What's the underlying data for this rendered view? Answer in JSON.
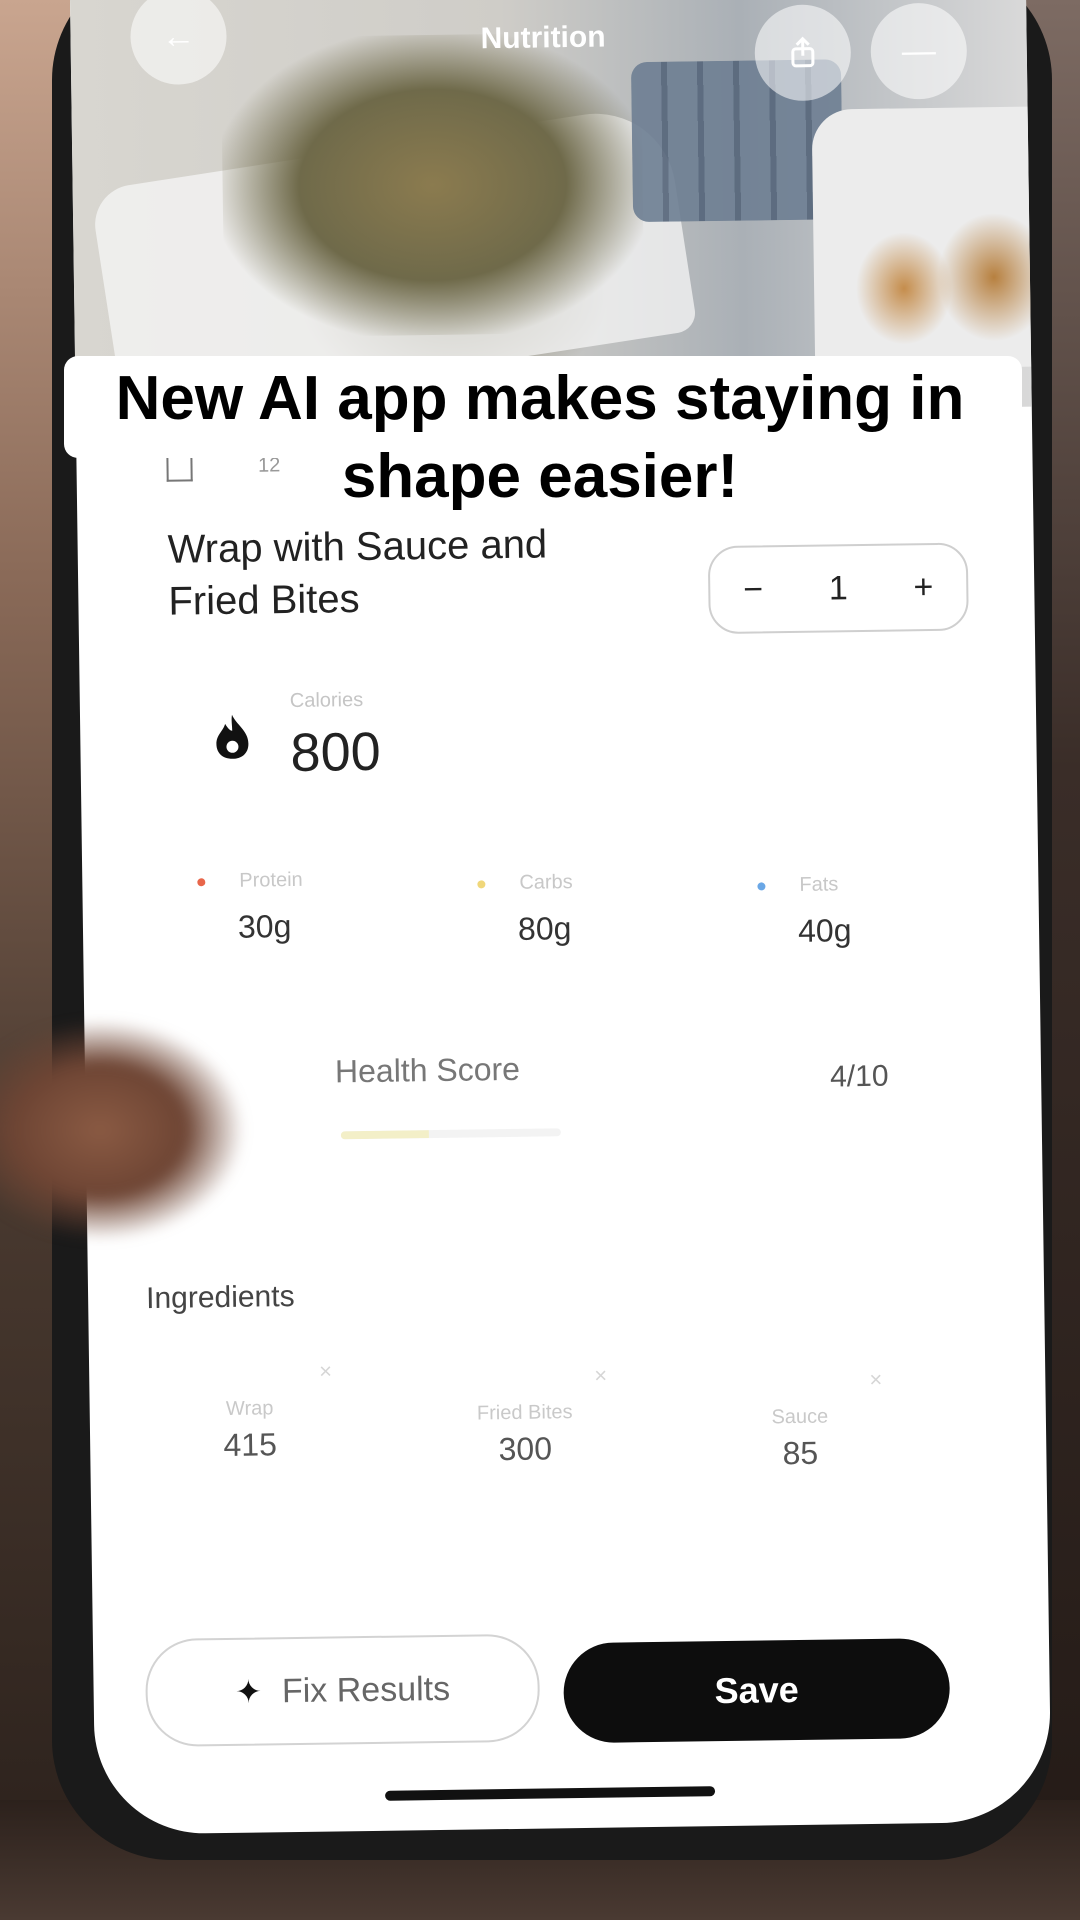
{
  "header": {
    "title": "Nutrition",
    "back_icon": "arrow-left-icon",
    "share_icon": "share-icon",
    "more_icon": "minus-icon"
  },
  "caption": {
    "line1": "New AI app makes staying in",
    "line2": "shape easier!"
  },
  "meal": {
    "time": "12",
    "title_line1": "Wrap with Sauce and",
    "title_line2": "Fried Bites",
    "quantity": "1",
    "decrement": "−",
    "increment": "+"
  },
  "calories": {
    "label": "Calories",
    "value": "800",
    "icon": "flame-icon"
  },
  "macros": [
    {
      "label": "Protein",
      "value": "30g",
      "color": "#e8664a"
    },
    {
      "label": "Carbs",
      "value": "80g",
      "color": "#f0d77a"
    },
    {
      "label": "Fats",
      "value": "40g",
      "color": "#6aa7e6"
    }
  ],
  "health": {
    "label": "Health Score",
    "value": "4/10",
    "score_fraction": 0.4
  },
  "ingredients": {
    "title": "Ingredients",
    "items": [
      {
        "name": "Wrap",
        "calories": "415"
      },
      {
        "name": "Fried Bites",
        "calories": "300"
      },
      {
        "name": "Sauce",
        "calories": "85"
      }
    ],
    "remove_symbol": "×"
  },
  "actions": {
    "fix_label": "Fix Results",
    "fix_icon": "sparkle-icon",
    "save_label": "Save"
  },
  "colors": {
    "primary_button": "#0d0d0d"
  }
}
